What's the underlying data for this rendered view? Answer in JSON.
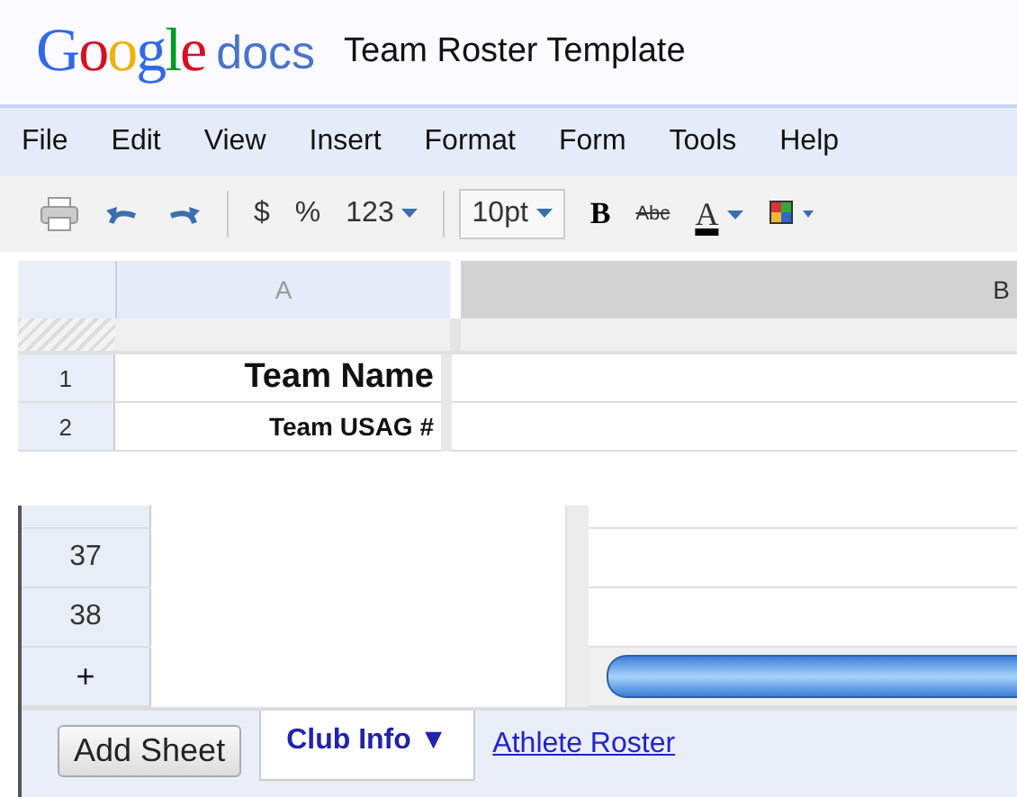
{
  "header": {
    "logo": "Google",
    "product": "docs",
    "title": "Team Roster Template"
  },
  "menu": [
    "File",
    "Edit",
    "View",
    "Insert",
    "Format",
    "Form",
    "Tools",
    "Help"
  ],
  "toolbar": [
    {
      "kind": "print"
    },
    {
      "kind": "undo"
    },
    {
      "kind": "redo"
    },
    {
      "kind": "sep"
    },
    {
      "kind": "text",
      "label": "$"
    },
    {
      "kind": "text",
      "label": "%"
    },
    {
      "kind": "menu",
      "label": "123"
    },
    {
      "kind": "sep"
    },
    {
      "kind": "boxmenu",
      "label": "10pt"
    },
    {
      "kind": "bold",
      "label": "B"
    },
    {
      "kind": "strike",
      "label": "Abc"
    },
    {
      "kind": "textcolor",
      "label": "A"
    },
    {
      "kind": "fill"
    }
  ],
  "columns": [
    {
      "label": "A",
      "selected": true
    },
    {
      "label": "B",
      "selected": false
    }
  ],
  "top_rows": [
    {
      "number": "1",
      "cell": "Team Name",
      "kind": "title"
    },
    {
      "number": "2",
      "cell": "Team USAG #",
      "kind": "field"
    }
  ],
  "bottom_rows": [
    {
      "number": ""
    },
    {
      "number": "37"
    },
    {
      "number": "38"
    }
  ],
  "add_row": "+",
  "add_sheet": "Add Sheet",
  "sheets": [
    {
      "label": "Club Info ▼",
      "selected": true
    },
    {
      "label": "Athlete Roster",
      "selected": false
    }
  ]
}
